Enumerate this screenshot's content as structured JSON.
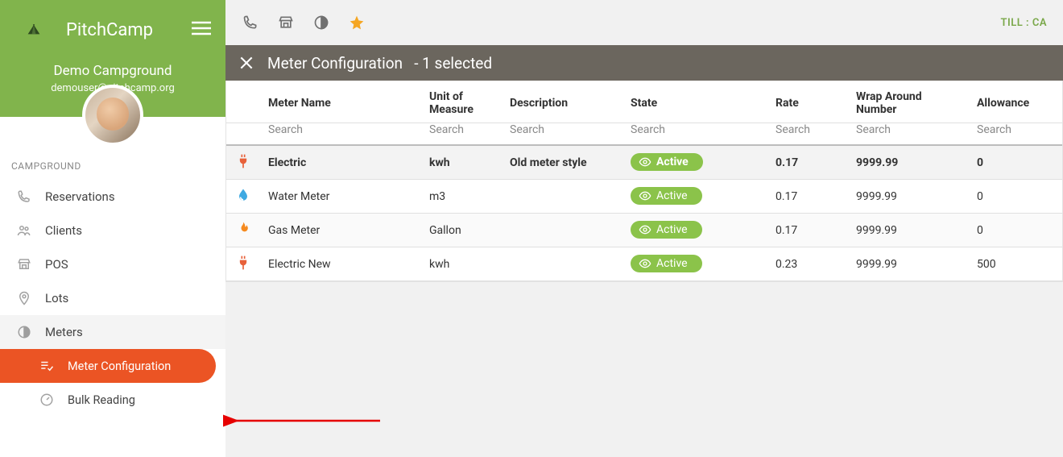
{
  "brand": {
    "name": "PitchCamp"
  },
  "campground": {
    "name": "Demo Campground",
    "email": "demouser@pitchcamp.org"
  },
  "sidebar": {
    "section_label": "CAMPGROUND",
    "items": [
      {
        "label": "Reservations",
        "icon": "phone"
      },
      {
        "label": "Clients",
        "icon": "people"
      },
      {
        "label": "POS",
        "icon": "store"
      },
      {
        "label": "Lots",
        "icon": "pin"
      },
      {
        "label": "Meters",
        "icon": "circle-half",
        "expanded": true
      },
      {
        "label": "Meter Configuration",
        "icon": "playlist-check",
        "sub": true,
        "active": true
      },
      {
        "label": "Bulk Reading",
        "icon": "gauge",
        "sub": true
      }
    ]
  },
  "topbar": {
    "till_label": "TILL : CA"
  },
  "title_bar": {
    "title": "Meter Configuration",
    "suffix": "- 1 selected"
  },
  "table": {
    "headers": [
      "Meter Name",
      "Unit of Measure",
      "Description",
      "State",
      "Rate",
      "Wrap Around Number",
      "Allowance"
    ],
    "search_placeholder": "Search",
    "rows": [
      {
        "icon": "plug",
        "icon_color": "#e8613a",
        "name": "Electric",
        "unit": "kwh",
        "description": "Old meter style",
        "state": "Active",
        "rate": "0.17",
        "wrap": "9999.99",
        "allowance": "0",
        "selected": true
      },
      {
        "icon": "water",
        "icon_color": "#3ea9e2",
        "name": "Water Meter",
        "unit": "m3",
        "description": "",
        "state": "Active",
        "rate": "0.17",
        "wrap": "9999.99",
        "allowance": "0",
        "selected": false
      },
      {
        "icon": "flame",
        "icon_color": "#f58a1f",
        "name": "Gas Meter",
        "unit": "Gallon",
        "description": "",
        "state": "Active",
        "rate": "0.17",
        "wrap": "9999.99",
        "allowance": "0",
        "selected": false
      },
      {
        "icon": "plug",
        "icon_color": "#e8613a",
        "name": "Electric New",
        "unit": "kwh",
        "description": "",
        "state": "Active",
        "rate": "0.23",
        "wrap": "9999.99",
        "allowance": "500",
        "selected": false
      }
    ]
  }
}
